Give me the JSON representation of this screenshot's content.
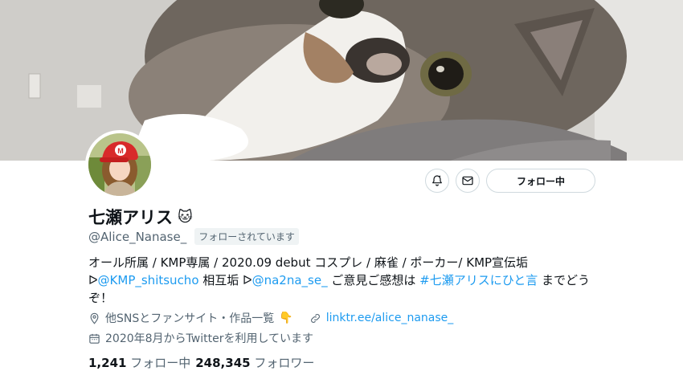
{
  "profile": {
    "display_name": "七瀬アリス",
    "name_emoji": "🐱",
    "handle": "@Alice_Nanase_",
    "follows_you_badge": "フォローされています"
  },
  "actions": {
    "follow_label": "フォロー中",
    "notify_icon": "bell-icon",
    "message_icon": "mail-icon"
  },
  "bio": {
    "line1": "オール所属 / KMP専属 / 2020.09 debut コスプレ / 麻雀 / ポーカー/ KMP宣伝垢",
    "arrow1": "ᐅ",
    "mention1": "@KMP_shitsucho",
    "text2": " 相互垢 ",
    "arrow2": "ᐅ",
    "mention2": "@na2na_se_",
    "text3": " ご意見ご感想は ",
    "hashtag": "#七瀬アリスにひと言",
    "text4": " までどうぞ！"
  },
  "meta": {
    "location": "他SNSとファンサイト・作品一覧",
    "location_emoji": "👇",
    "website": "linktr.ee/alice_nanase_",
    "joined": "2020年8月からTwitterを利用しています"
  },
  "stats": {
    "following_count": "1,241",
    "following_label": "フォロー中",
    "followers_count": "248,345",
    "followers_label": "フォロワー"
  },
  "colors": {
    "link": "#1d9bf0",
    "muted": "#536471",
    "border": "#cfd9de"
  }
}
